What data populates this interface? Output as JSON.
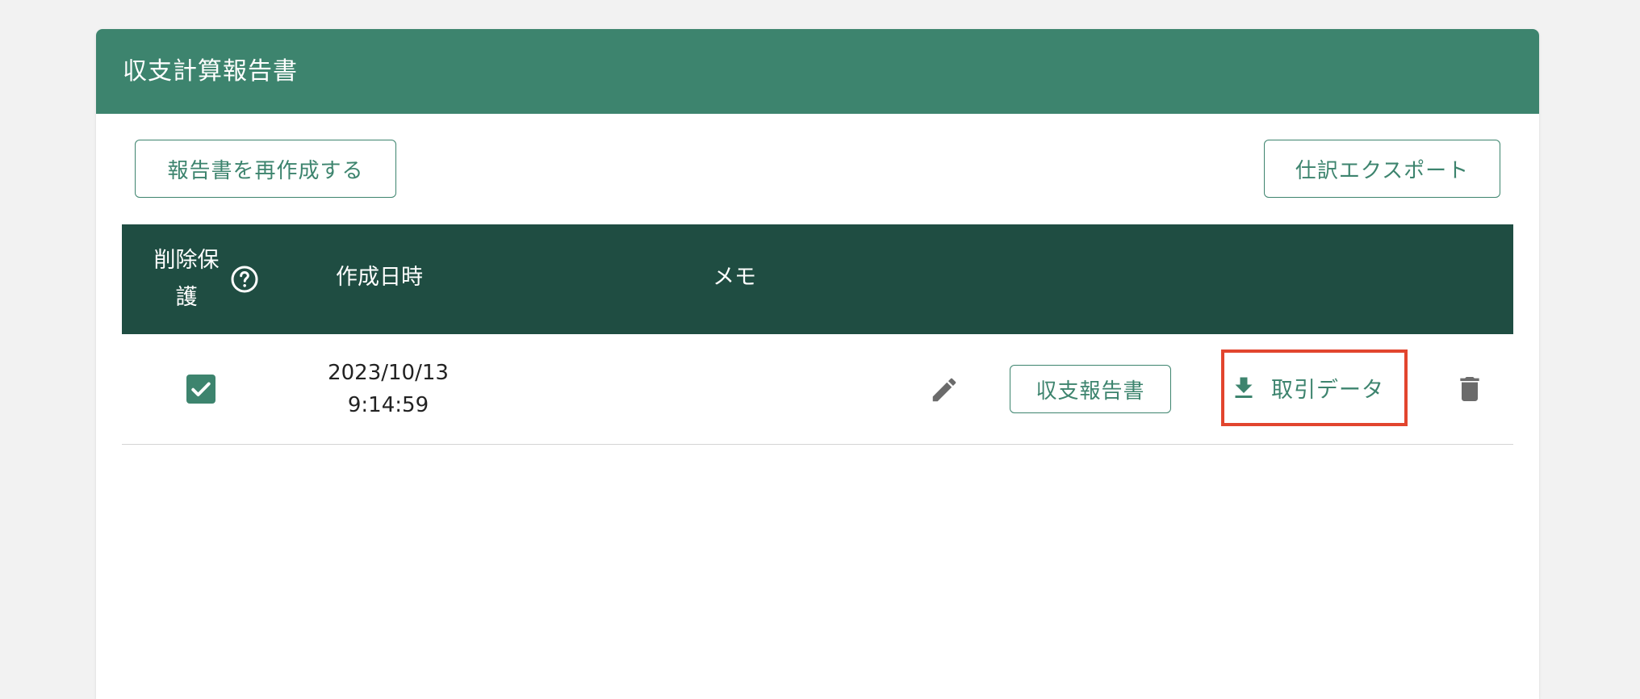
{
  "panel": {
    "title": "収支計算報告書"
  },
  "toolbar": {
    "regenerate_label": "報告書を再作成する",
    "export_label": "仕訳エクスポート"
  },
  "table": {
    "headers": {
      "protect": "削除保護",
      "created_at": "作成日時",
      "memo": "メモ"
    },
    "rows": [
      {
        "protected": true,
        "date": "2023/10/13",
        "time": "9:14:59",
        "memo": "",
        "report_label": "収支報告書",
        "download_label": "取引データ"
      }
    ]
  },
  "icons": {
    "help": "help-circle-icon",
    "check": "check-icon",
    "edit": "pencil-icon",
    "download": "download-icon",
    "delete": "trash-icon"
  },
  "colors": {
    "header_green": "#3d846e",
    "table_header": "#1f4d42",
    "highlight": "#e2452e",
    "icon_gray": "#6b6b6b"
  }
}
